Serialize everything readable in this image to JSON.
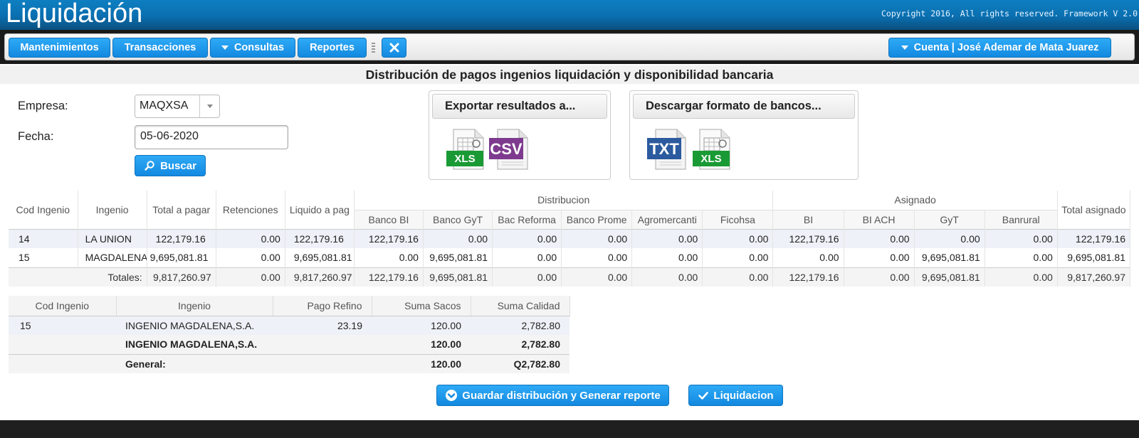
{
  "header": {
    "app_title": "Liquidación",
    "copyright": "Copyright 2016, All rights reserved. Framework V 2.0"
  },
  "menu": {
    "mantenimientos": "Mantenimientos",
    "transacciones": "Transacciones",
    "consultas": "Consultas",
    "reportes": "Reportes",
    "cuenta": "Cuenta | José Ademar de Mata Juarez"
  },
  "page": {
    "title": "Distribución de pagos ingenios liquidación y disponibilidad bancaria"
  },
  "form": {
    "empresa_label": "Empresa:",
    "empresa_value": "MAQXSA",
    "fecha_label": "Fecha:",
    "fecha_value": "05-06-2020",
    "buscar_label": "Buscar"
  },
  "export": {
    "export_title": "Exportar resultados a...",
    "download_title": "Descargar formato de bancos...",
    "xls": "XLS",
    "csv": "CSV",
    "txt": "TXT"
  },
  "main_table": {
    "group_headers": {
      "distribucion": "Distribucion",
      "asignado": "Asignado"
    },
    "headers": {
      "cod_ingenio": "Cod Ingenio",
      "ingenio": "Ingenio",
      "total_a_pagar": "Total a pagar",
      "retenciones": "Retenciones",
      "liquido": "Liquido a pag",
      "banco_bi": "Banco BI",
      "banco_gyt": "Banco GyT",
      "bac_reforma": "Bac Reforma",
      "banco_prome": "Banco Prome",
      "agromercanti": "Agromercanti",
      "ficohsa": "Ficohsa",
      "bi": "BI",
      "bi_ach": "BI ACH",
      "gyt": "GyT",
      "banrural": "Banrural",
      "total_asignado": "Total asignado"
    },
    "rows": [
      [
        "14",
        "LA UNION",
        "122,179.16",
        "0.00",
        "122,179.16",
        "122,179.16",
        "0.00",
        "0.00",
        "0.00",
        "0.00",
        "0.00",
        "122,179.16",
        "0.00",
        "0.00",
        "0.00",
        "122,179.16"
      ],
      [
        "15",
        "MAGDALENA",
        "9,695,081.81",
        "0.00",
        "9,695,081.81",
        "0.00",
        "9,695,081.81",
        "0.00",
        "0.00",
        "0.00",
        "0.00",
        "0.00",
        "0.00",
        "9,695,081.81",
        "0.00",
        "9,695,081.81"
      ]
    ],
    "totals": [
      "Totales:",
      "9,817,260.97",
      "0.00",
      "9,817,260.97",
      "122,179.16",
      "9,695,081.81",
      "0.00",
      "0.00",
      "0.00",
      "0.00",
      "122,179.16",
      "0.00",
      "9,695,081.81",
      "0.00",
      "9,817,260.97"
    ]
  },
  "detail_table": {
    "headers": {
      "cod_ingenio": "Cod Ingenio",
      "ingenio": "Ingenio",
      "pago_refino": "Pago Refino",
      "suma_sacos": "Suma Sacos",
      "suma_calidad": "Suma Calidad"
    },
    "row": {
      "cod": "15",
      "ingenio": "INGENIO MAGDALENA,S.A.",
      "pago_refino": "23.19",
      "suma_sacos": "120.00",
      "suma_calidad": "2,782.80"
    },
    "subtotal": {
      "ingenio": "INGENIO MAGDALENA,S.A.",
      "suma_sacos": "120.00",
      "suma_calidad": "2,782.80"
    },
    "general": {
      "label": "General:",
      "suma_sacos": "120.00",
      "suma_calidad": "Q2,782.80"
    }
  },
  "actions": {
    "guardar": "Guardar distribución y Generar reporte",
    "liquidacion": "Liquidacion"
  }
}
